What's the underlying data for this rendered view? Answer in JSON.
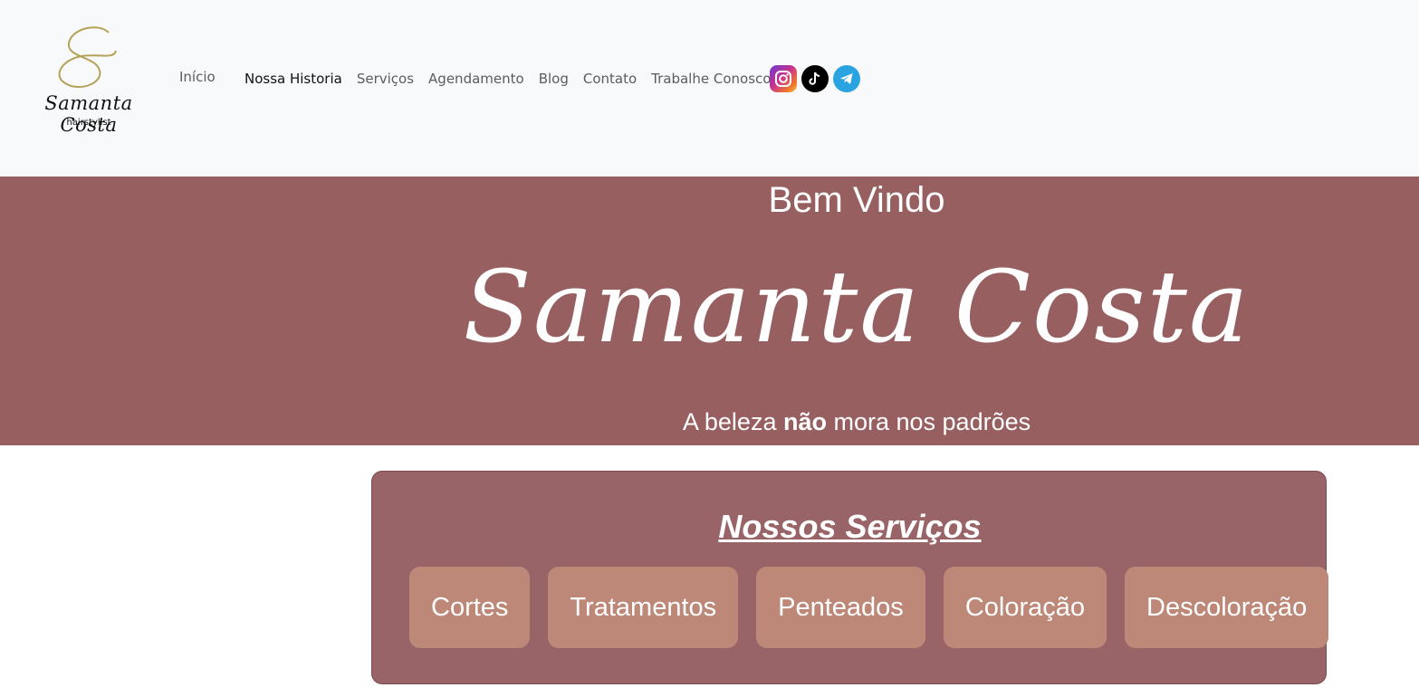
{
  "brand": {
    "name": "Samanta Costa",
    "subtitle": "hairstylist"
  },
  "nav": {
    "home": "Início",
    "links": [
      "Nossa Historia",
      "Serviços",
      "Agendamento",
      "Blog",
      "Contato",
      "Trabalhe Conosco"
    ]
  },
  "socials": [
    {
      "icon": "instagram-icon",
      "color": "#c7318f"
    },
    {
      "icon": "tiktok-icon",
      "color": "#000000"
    },
    {
      "icon": "telegram-icon",
      "color": "#2aa4e0"
    }
  ],
  "hero": {
    "welcome": "Bem Vindo",
    "name": "Samanta Costa",
    "tagline_pre": "A beleza ",
    "tagline_bold": "não",
    "tagline_post": " mora nos padrões",
    "bg_color": "#975f60"
  },
  "services": {
    "title": "Nossos Serviços",
    "items": [
      "Cortes",
      "Tratamentos",
      "Penteados",
      "Coloração",
      "Descoloração"
    ],
    "bg_color": "#986467",
    "button_color": "#bd8878"
  }
}
